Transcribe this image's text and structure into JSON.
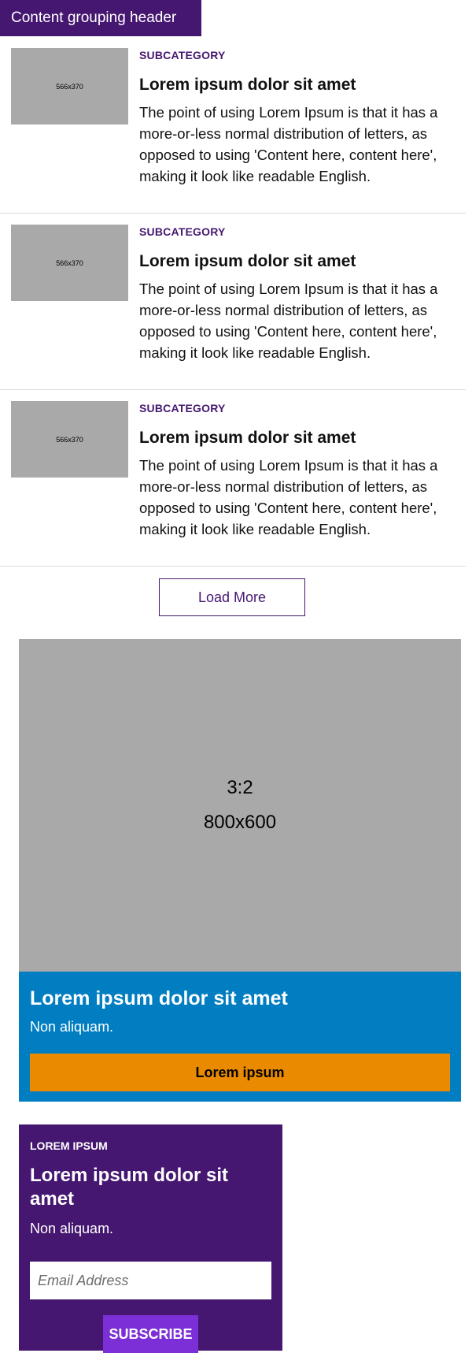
{
  "group_header": "Content grouping header",
  "articles": [
    {
      "image_label": "566x370",
      "subcategory": "SUBCATEGORY",
      "title": "Lorem ipsum dolor sit amet",
      "body": "The point of using Lorem Ipsum is that it has a more-or-less normal distribution of letters, as opposed to using 'Content here, content here', making it look like readable English."
    },
    {
      "image_label": "566x370",
      "subcategory": "SUBCATEGORY",
      "title": "Lorem ipsum dolor sit amet",
      "body": "The point of using Lorem Ipsum is that it has a more-or-less normal distribution of letters, as opposed to using 'Content here, content here', making it look like readable English."
    },
    {
      "image_label": "566x370",
      "subcategory": "SUBCATEGORY",
      "title": "Lorem ipsum dolor sit amet",
      "body": "The point of using Lorem Ipsum is that it has a more-or-less normal distribution of letters, as opposed to using 'Content here, content here', making it look like readable English."
    }
  ],
  "load_more_label": "Load More",
  "promo": {
    "image_ratio": "3:2",
    "image_size": "800x600",
    "title": "Lorem ipsum dolor sit amet",
    "subtitle": "Non aliquam.",
    "cta_label": "Lorem ipsum"
  },
  "newsletter": {
    "eyebrow": "LOREM IPSUM",
    "title": "Lorem ipsum dolor sit amet",
    "subtitle": "Non aliquam.",
    "email_placeholder": "Email Address",
    "subscribe_label": "SUBSCRIBE"
  },
  "colors": {
    "brand_purple": "#451770",
    "promo_blue": "#007ec1",
    "cta_orange": "#ea8a00",
    "subscribe_violet": "#7c2fd6",
    "placeholder_gray": "#a9a9a9"
  }
}
